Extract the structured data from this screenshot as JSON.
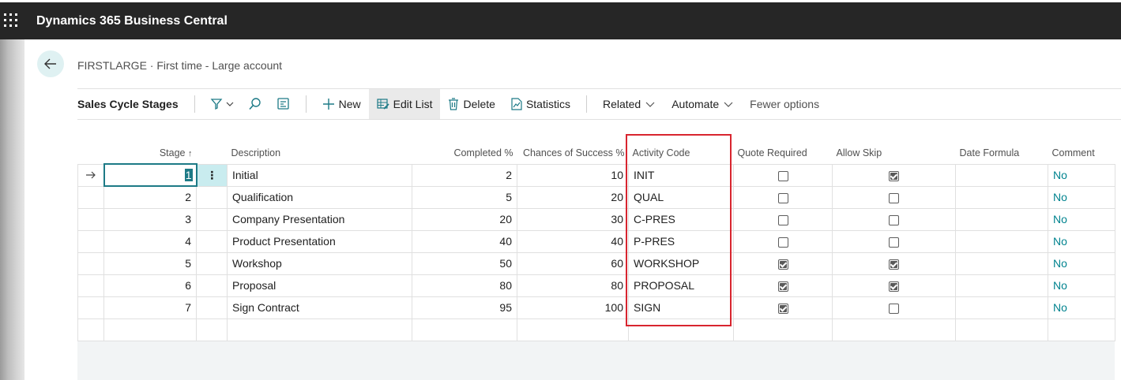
{
  "app": {
    "title": "Dynamics 365 Business Central"
  },
  "page": {
    "caption": "FIRSTLARGE · First time - Large account"
  },
  "actionbar": {
    "title": "Sales Cycle Stages",
    "new_label": "New",
    "edit_list_label": "Edit List",
    "delete_label": "Delete",
    "statistics_label": "Statistics",
    "related_label": "Related",
    "automate_label": "Automate",
    "fewer_options_label": "Fewer options"
  },
  "grid": {
    "columns": {
      "stage": "Stage",
      "sort_indicator": "↑",
      "description": "Description",
      "completed": "Completed %",
      "chances": "Chances of Success %",
      "activity_code": "Activity Code",
      "quote_required": "Quote Required",
      "allow_skip": "Allow Skip",
      "date_formula": "Date Formula",
      "comment": "Comment"
    },
    "row_menu_glyph": "⋮",
    "rows": [
      {
        "stage": "1",
        "description": "Initial",
        "completed": "2",
        "chances": "10",
        "activity_code": "INIT",
        "quote_required": false,
        "allow_skip": true,
        "date_formula": "",
        "comment": "No"
      },
      {
        "stage": "2",
        "description": "Qualification",
        "completed": "5",
        "chances": "20",
        "activity_code": "QUAL",
        "quote_required": false,
        "allow_skip": false,
        "date_formula": "",
        "comment": "No"
      },
      {
        "stage": "3",
        "description": "Company Presentation",
        "completed": "20",
        "chances": "30",
        "activity_code": "C-PRES",
        "quote_required": false,
        "allow_skip": false,
        "date_formula": "",
        "comment": "No"
      },
      {
        "stage": "4",
        "description": "Product Presentation",
        "completed": "40",
        "chances": "40",
        "activity_code": "P-PRES",
        "quote_required": false,
        "allow_skip": false,
        "date_formula": "",
        "comment": "No"
      },
      {
        "stage": "5",
        "description": "Workshop",
        "completed": "50",
        "chances": "60",
        "activity_code": "WORKSHOP",
        "quote_required": true,
        "allow_skip": true,
        "date_formula": "",
        "comment": "No"
      },
      {
        "stage": "6",
        "description": "Proposal",
        "completed": "80",
        "chances": "80",
        "activity_code": "PROPOSAL",
        "quote_required": true,
        "allow_skip": true,
        "date_formula": "",
        "comment": "No"
      },
      {
        "stage": "7",
        "description": "Sign Contract",
        "completed": "95",
        "chances": "100",
        "activity_code": "SIGN",
        "quote_required": true,
        "allow_skip": false,
        "date_formula": "",
        "comment": "No"
      }
    ]
  },
  "colors": {
    "accent": "#00838f",
    "highlight_box": "#d8252f",
    "topbar": "#262626"
  }
}
